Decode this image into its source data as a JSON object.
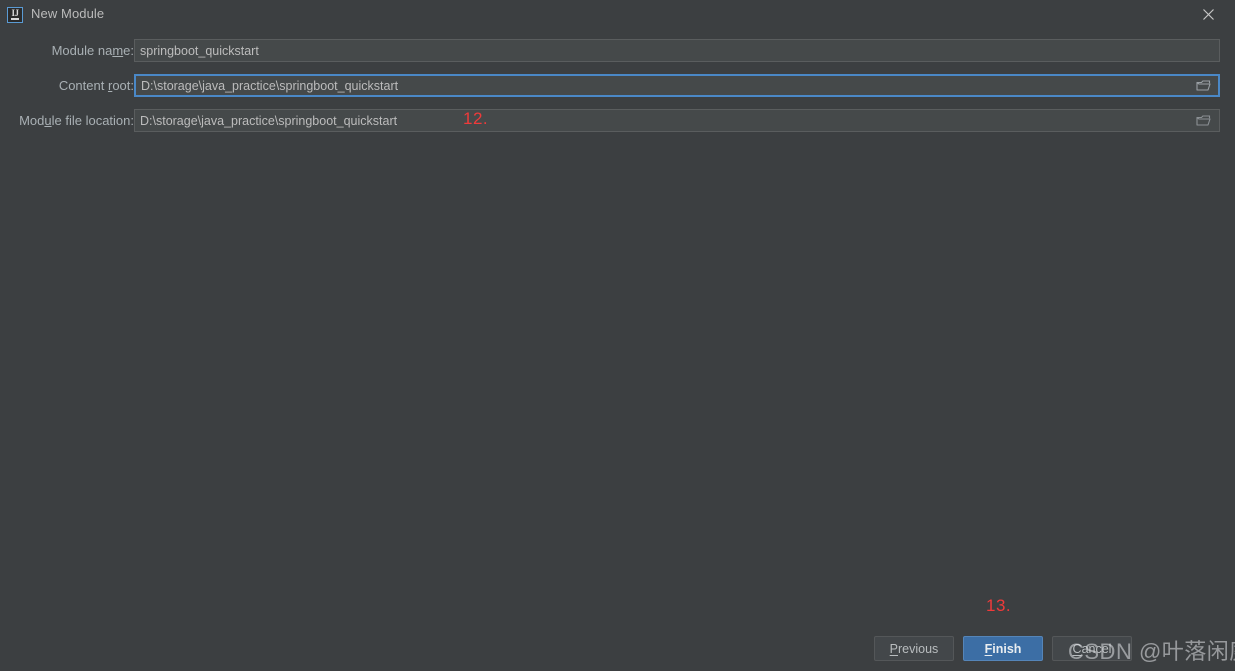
{
  "window": {
    "title": "New Module",
    "app_icon_text": "IJ",
    "close_icon": "close-icon",
    "background_color": "#3c3f41"
  },
  "form": {
    "rows": [
      {
        "label_pre": "Module na",
        "label_mnemonic": "m",
        "label_post": "e:",
        "label_full": "Module name:",
        "value": "springboot_quickstart",
        "has_browse": false,
        "focused": false
      },
      {
        "label_pre": "Content ",
        "label_mnemonic": "r",
        "label_post": "oot:",
        "label_full": "Content root:",
        "value": "D:\\storage\\java_practice\\springboot_quickstart",
        "has_browse": true,
        "focused": true
      },
      {
        "label_pre": "Mod",
        "label_mnemonic": "u",
        "label_post": "le file location:",
        "label_full": "Module file location:",
        "value": "D:\\storage\\java_practice\\springboot_quickstart",
        "has_browse": true,
        "focused": false
      }
    ],
    "browse_icon": "folder-icon"
  },
  "annotations": [
    {
      "text": "12.",
      "color": "#ef3a3a"
    },
    {
      "text": "13.",
      "color": "#ef3a3a"
    }
  ],
  "buttons": {
    "previous": {
      "pre": "",
      "mnemonic": "P",
      "post": "revious",
      "full": "Previous"
    },
    "finish": {
      "pre": "",
      "mnemonic": "F",
      "post": "inish",
      "full": "Finish",
      "accent_color": "#3c6ea5",
      "primary": true
    },
    "cancel": {
      "pre": "",
      "mnemonic": "C",
      "post": "ancel",
      "full": "Cancel"
    }
  },
  "watermark": {
    "text": "CSDN @叶落闲庭"
  }
}
